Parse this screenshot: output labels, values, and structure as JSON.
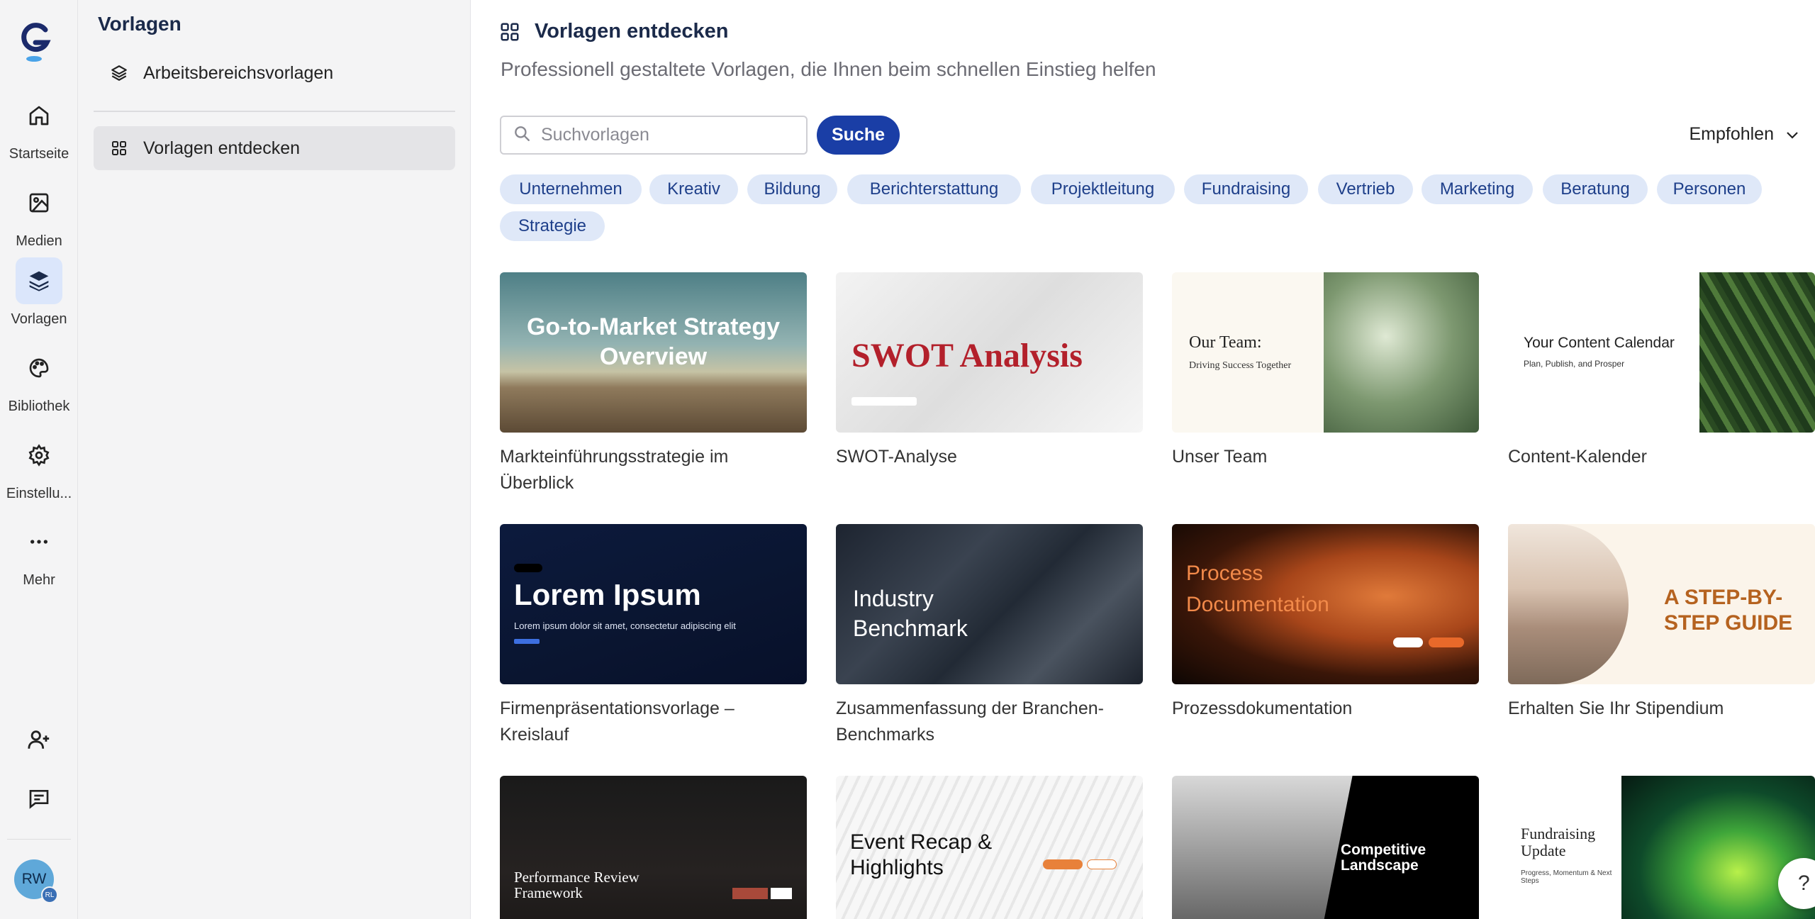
{
  "rail": {
    "items": [
      {
        "label": "Startseite",
        "icon": "home-icon"
      },
      {
        "label": "Medien",
        "icon": "image-icon"
      },
      {
        "label": "Vorlagen",
        "icon": "layers-icon",
        "active": true
      },
      {
        "label": "Bibliothek",
        "icon": "palette-icon"
      },
      {
        "label": "Einstellu...",
        "icon": "gear-icon"
      },
      {
        "label": "Mehr",
        "icon": "more-icon"
      }
    ],
    "avatar_initials": "RW",
    "avatar_badge": "RL"
  },
  "sidebar": {
    "title": "Vorlagen",
    "items": [
      {
        "label": "Arbeitsbereichsvorlagen"
      },
      {
        "label": "Vorlagen entdecken",
        "active": true
      }
    ]
  },
  "main": {
    "title": "Vorlagen entdecken",
    "subtitle": "Professionell gestaltete Vorlagen, die Ihnen beim schnellen Einstieg helfen",
    "search_placeholder": "Suchvorlagen",
    "search_button": "Suche",
    "sort_label": "Empfohlen",
    "categories": [
      "Unternehmen",
      "Kreativ",
      "Bildung",
      "Berichterstattung",
      "Projektleitung",
      "Fundraising",
      "Vertrieb",
      "Marketing",
      "Beratung",
      "Personen",
      "Strategie"
    ],
    "templates": [
      {
        "title": "Markteinführungsstrategie im Überblick",
        "thumb_text": "Go-to-Market Strategy Overview"
      },
      {
        "title": "SWOT-Analyse",
        "thumb_text": "SWOT Analysis"
      },
      {
        "title": "Unser Team",
        "thumb_text": "Our Team:",
        "thumb_sub": "Driving Success Together"
      },
      {
        "title": "Content-Kalender",
        "thumb_text": "Your Content Calendar",
        "thumb_sub": "Plan, Publish, and Prosper"
      },
      {
        "title": "Firmenpräsentationsvorlage – Kreislauf",
        "thumb_text": "Lorem Ipsum",
        "thumb_sub": "Lorem ipsum dolor sit amet, consectetur adipiscing elit"
      },
      {
        "title": "Zusammenfassung der Branchen-Benchmarks",
        "thumb_text": "Industry Benchmark"
      },
      {
        "title": "Prozessdokumentation",
        "thumb_text": "Process Documentation"
      },
      {
        "title": "Erhalten Sie Ihr Stipendium",
        "thumb_text": "A STEP-BY-STEP GUIDE"
      },
      {
        "title": "",
        "thumb_text": "Performance Review Framework"
      },
      {
        "title": "",
        "thumb_text": "Event Recap & Highlights"
      },
      {
        "title": "",
        "thumb_text": "Competitive Landscape"
      },
      {
        "title": "",
        "thumb_text": "Fundraising Update",
        "thumb_sub": "Progress, Momentum & Next Steps"
      }
    ]
  },
  "help_label": "?",
  "colors": {
    "accent": "#1a3ea6",
    "chip_bg": "#dfe8f8",
    "chip_text": "#1e3f8a",
    "active_rail": "#dbe6fb"
  }
}
